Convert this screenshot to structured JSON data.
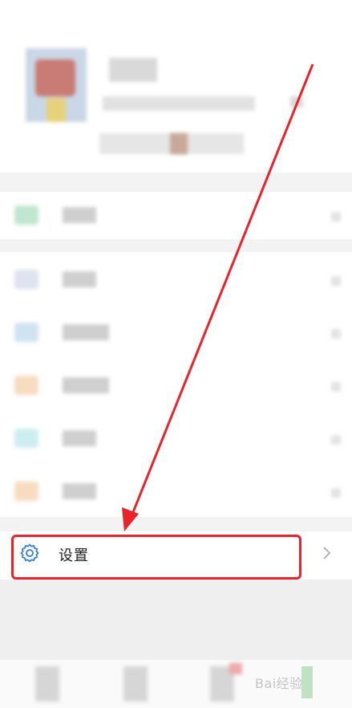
{
  "settings": {
    "label": "设置"
  },
  "watermark": {
    "text": "Bai经验"
  },
  "colors": {
    "highlight": "#e8232a",
    "icon_blue": "#2f7fd8",
    "background": "#ffffff",
    "gray_band": "#efefef"
  },
  "icons": {
    "settings": "gear-icon",
    "chevron": "chevron-right-icon"
  }
}
